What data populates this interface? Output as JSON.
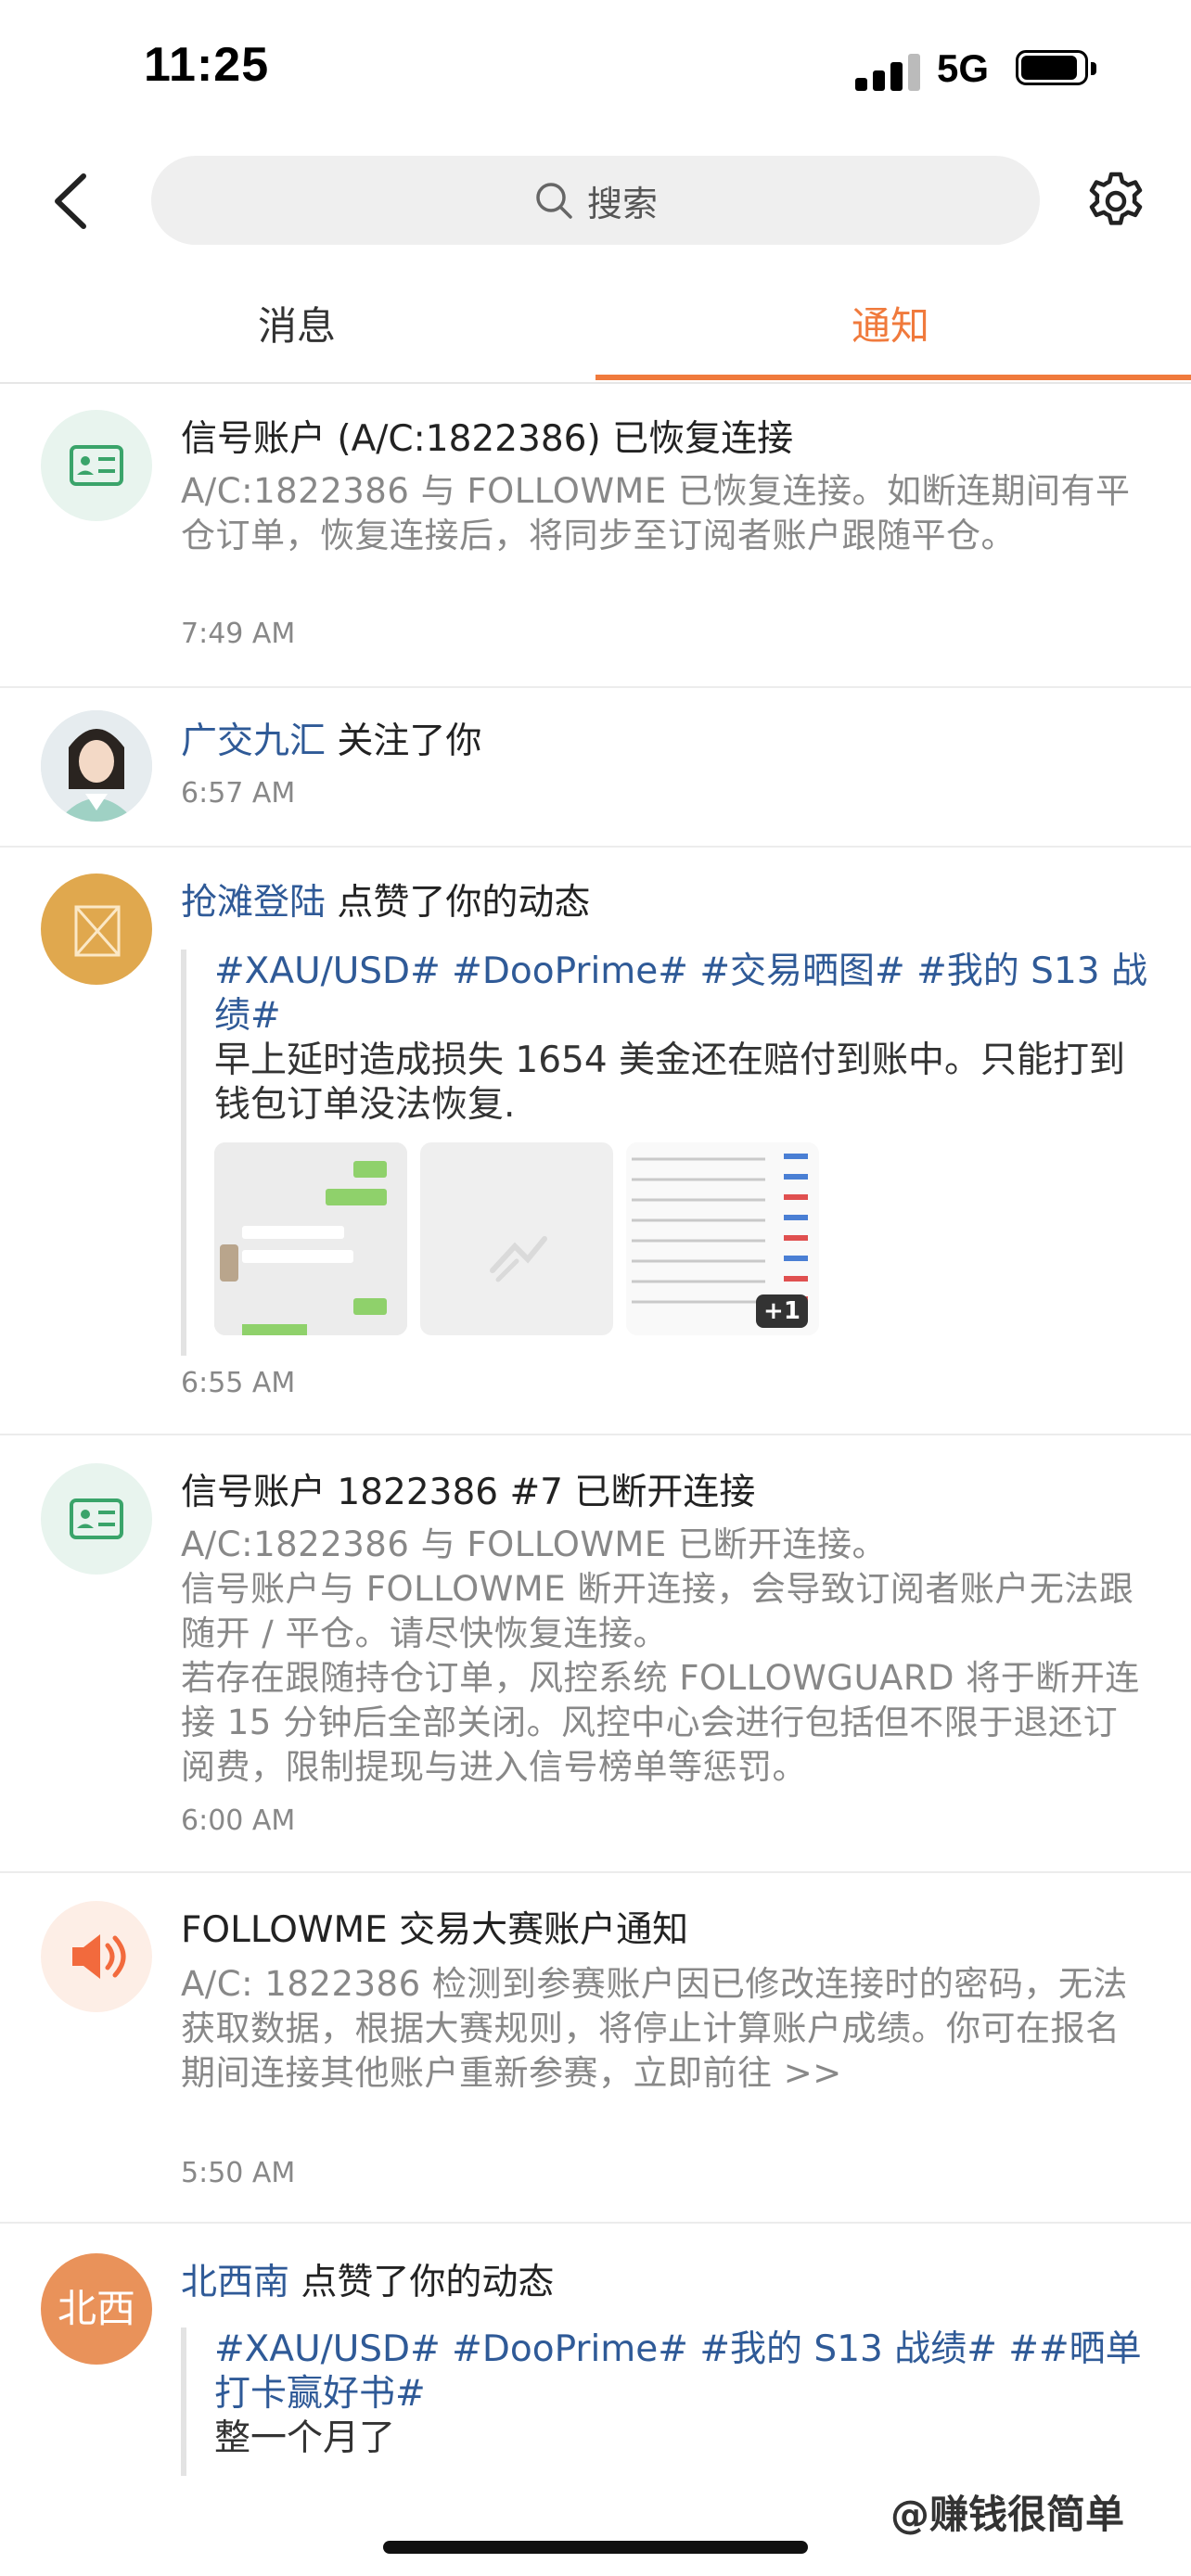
{
  "status_bar": {
    "time": "11:25",
    "network": "5G"
  },
  "header": {
    "search_placeholder": "搜索"
  },
  "tabs": [
    {
      "label": "消息",
      "active": false
    },
    {
      "label": "通知",
      "active": true
    }
  ],
  "colors": {
    "accent": "#f07a3c",
    "link_blue": "#2f5a97",
    "muted_text": "#888888"
  },
  "notifications": [
    {
      "icon": "id-card-icon",
      "title": "信号账户 (A/C:1822386) 已恢复连接",
      "body": [
        "A/C:1822386 与 FOLLOWME 已恢复连接。如断连期间有平仓订单，恢复连接后，将同步至订阅者账户跟随平仓。"
      ],
      "time": "7:49 AM"
    },
    {
      "user": "广交九汇",
      "action": "关注了你",
      "time": "6:57 AM"
    },
    {
      "user": "抢滩登陆",
      "action": "点赞了你的动态",
      "post": {
        "tags": "#XAU/USD# #DooPrime# #交易晒图# #我的 S13 战绩#",
        "text": "早上延时造成损失 1654 美金还在赔付到账中。只能打到钱包订单没法恢复.",
        "more_count": "+1"
      },
      "time": "6:55 AM"
    },
    {
      "icon": "id-card-icon",
      "title": "信号账户 1822386 #7 已断开连接",
      "body": [
        "A/C:1822386 与 FOLLOWME 已断开连接。",
        "信号账户与 FOLLOWME 断开连接，会导致订阅者账户无法跟随开 / 平仓。请尽快恢复连接。",
        "若存在跟随持仓订单，风控系统 FOLLOWGUARD 将于断开连接 15 分钟后全部关闭。风控中心会进行包括但不限于退还订阅费，限制提现与进入信号榜单等惩罚。"
      ],
      "time": "6:00 AM"
    },
    {
      "icon": "speaker-icon",
      "title": "FOLLOWME 交易大赛账户通知",
      "body": [
        "A/C: 1822386 检测到参赛账户因已修改连接时的密码，无法获取数据，根据大赛规则，将停止计算账户成绩。你可在报名期间连接其他账户重新参赛，立即前往 >>"
      ],
      "time": "5:50 AM"
    },
    {
      "user": "北西南",
      "avatar_text": "北西",
      "action": "点赞了你的动态",
      "post": {
        "tags": "#XAU/USD# #DooPrime# #我的 S13 战绩# ##晒单打卡赢好书#",
        "text": "整一个月了"
      }
    }
  ],
  "watermark": "@赚钱很简单"
}
